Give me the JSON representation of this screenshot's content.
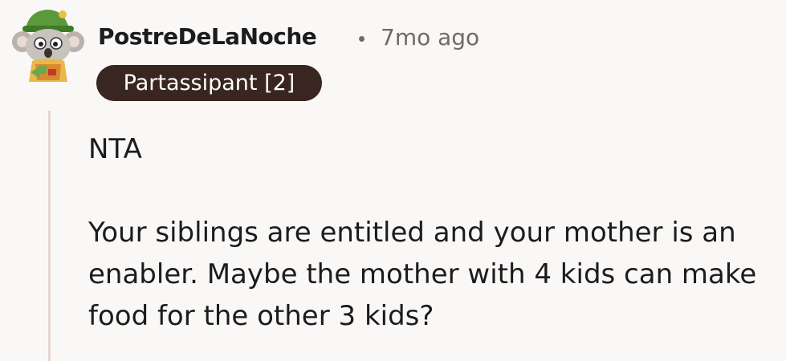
{
  "comment": {
    "author": "PostreDeLaNoche",
    "separator": "•",
    "timestamp": "7mo ago",
    "flair": "Partassipant [2]",
    "avatar_icon": "koala-avatar-icon",
    "paragraphs": [
      "NTA",
      "Your siblings are entitled and your mother is an enabler. Maybe the mother with 4 kids can make food for the other 3 kids?"
    ]
  },
  "colors": {
    "background": "#faf8f7",
    "flair_bg": "#3a2620",
    "thread_line": "#e4d6d0",
    "meta_text": "#6f6a66"
  }
}
